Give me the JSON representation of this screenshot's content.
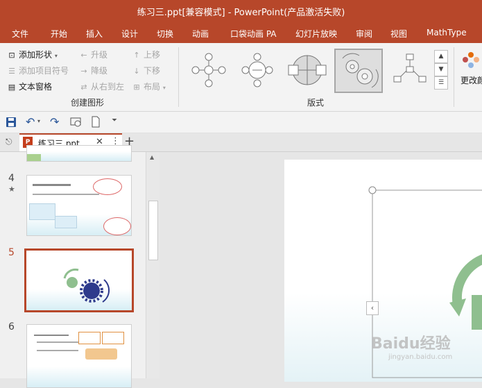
{
  "window": {
    "title": "练习三.ppt[兼容模式] - PowerPoint(产品激活失败)"
  },
  "menu": {
    "tabs": [
      "文件",
      "开始",
      "插入",
      "设计",
      "切换",
      "动画",
      "口袋动画 PA",
      "幻灯片放映",
      "审阅",
      "视图",
      "MathType"
    ]
  },
  "ribbon": {
    "create_group": {
      "label": "创建图形",
      "add_shape": "添加形状",
      "add_bullet": "添加项目符号",
      "text_pane": "文本窗格",
      "promote": "升级",
      "demote": "降级",
      "rtl": "从右到左",
      "move_up": "上移",
      "move_down": "下移",
      "layout": "布局"
    },
    "layout_group": {
      "label": "版式"
    },
    "change_colors": "更改颜"
  },
  "document": {
    "tab_name": "练习三.ppt"
  },
  "slides": [
    {
      "number": "4",
      "star": "★"
    },
    {
      "number": "5"
    },
    {
      "number": "6"
    }
  ],
  "colors": {
    "accent": "#b7472a",
    "gear_green": "#8fbf8f",
    "gear_navy": "#2e3a8c"
  },
  "watermark": {
    "text": "Baidu经验",
    "url": "jingyan.baidu.com"
  }
}
